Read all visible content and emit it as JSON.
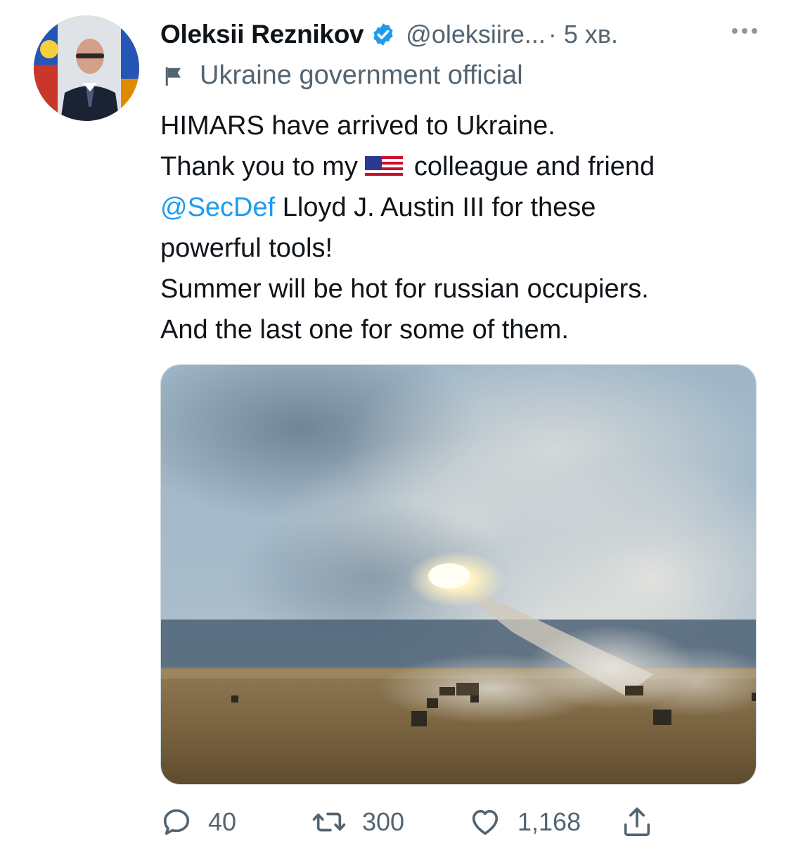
{
  "tweet": {
    "author": {
      "name": "Oleksii Reznikov",
      "handle": "@oleksiire...",
      "verified": true
    },
    "time": "· 5 хв.",
    "label": "Ukraine government official",
    "text": {
      "line1": "HIMARS have arrived to Ukraine.",
      "line2_before": "Thank you to my",
      "line2_emoji": "us-flag-icon",
      "line2_after": "colleague and friend",
      "mention": "@SecDef",
      "line3_after": " Lloyd J. Austin III for these",
      "line4": "powerful tools!",
      "line5": "Summer will be hot for russian occupiers.",
      "line6": "And the last one for some of them."
    },
    "stats": {
      "replies": "40",
      "retweets": "300",
      "likes": "1,168"
    }
  },
  "icons": {
    "verified": "verified-badge-icon",
    "label": "flag-icon",
    "more": "more-icon",
    "reply": "reply-icon",
    "retweet": "retweet-icon",
    "like": "heart-icon",
    "share": "share-icon"
  },
  "colors": {
    "accent": "#1d9bf0",
    "secondary_text": "#536471",
    "primary_text": "#0f1419"
  }
}
